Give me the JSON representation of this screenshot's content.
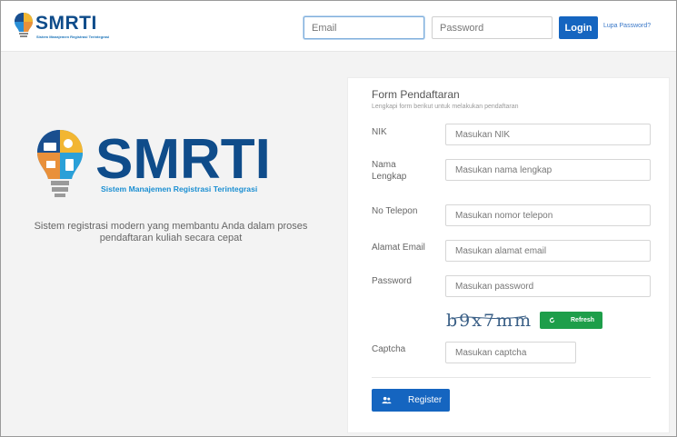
{
  "navbar": {
    "brand_name": "SMRTI",
    "brand_tagline": "Sistem Manajemen Registrasi Terintegrasi",
    "email_placeholder": "Email",
    "password_placeholder": "Password",
    "login_label": "Login",
    "forgot_label": "Lupa Password?"
  },
  "hero": {
    "logo_text": "SMRTI",
    "logo_tagline": "Sistem Manajemen Registrasi Terintegrasi",
    "description": "Sistem registrasi modern yang membantu Anda dalam proses pendaftaran kuliah secara cepat"
  },
  "form": {
    "title": "Form Pendaftaran",
    "subtitle": "Lengkapi form berikut untuk melakukan pendaftaran",
    "fields": {
      "nik": {
        "label": "NIK",
        "placeholder": "Masukan NIK"
      },
      "nama": {
        "label": "Nama Lengkap",
        "placeholder": "Masukan nama lengkap"
      },
      "telepon": {
        "label": "No Telepon",
        "placeholder": "Masukan nomor telepon"
      },
      "email": {
        "label": "Alamat Email",
        "placeholder": "Masukan alamat email"
      },
      "password": {
        "label": "Password",
        "placeholder": "Masukan password"
      },
      "captcha": {
        "label": "Captcha",
        "placeholder": "Masukan captcha"
      }
    },
    "captcha_text": "b9x7mm",
    "refresh_label": "Refresh",
    "register_label": "Register"
  },
  "colors": {
    "primary": "#1565c0",
    "success": "#1e9e4a",
    "brand_dark": "#0f4c8a",
    "brand_light": "#1b73b8"
  }
}
